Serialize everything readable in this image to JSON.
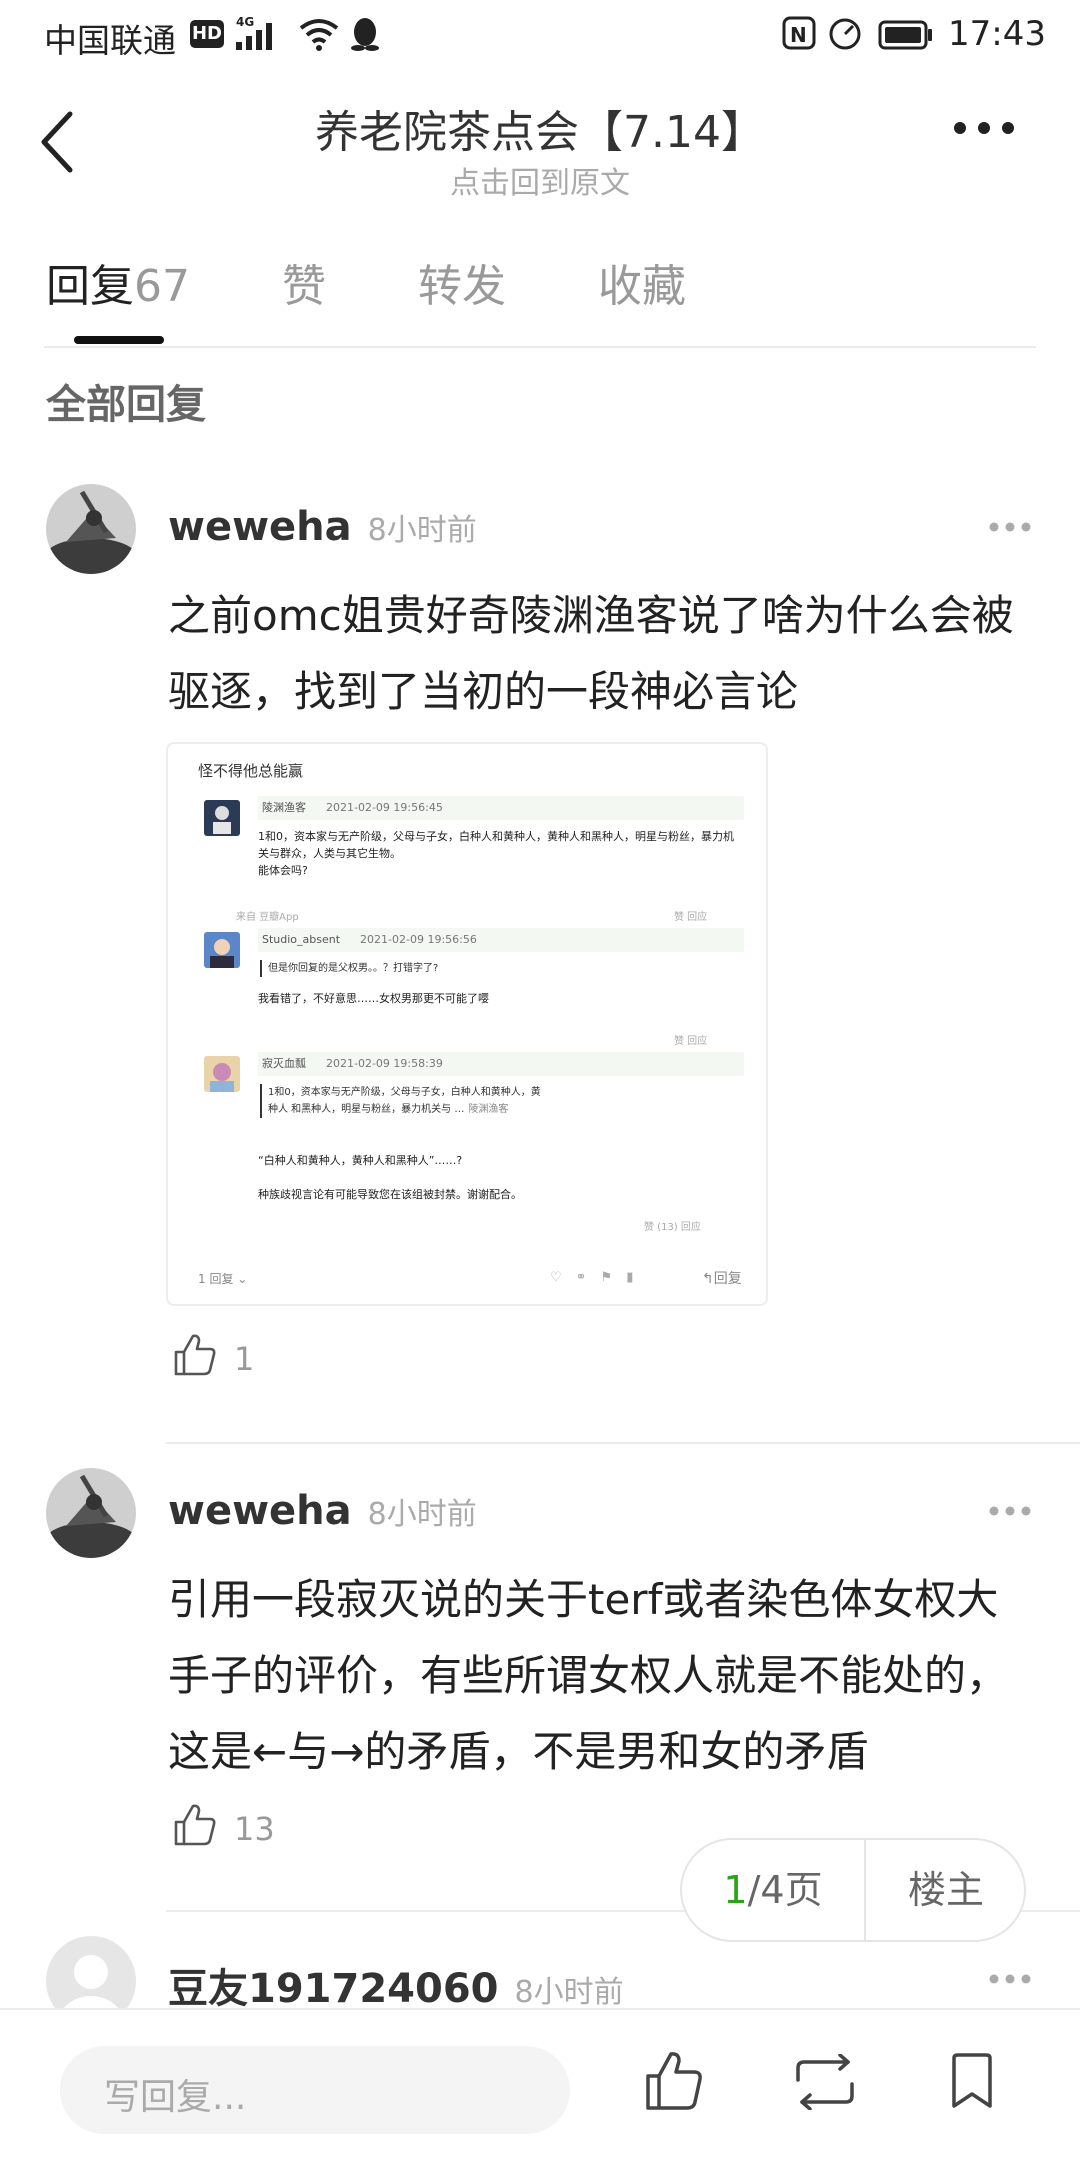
{
  "status_bar": {
    "carrier": "中国联通",
    "hd": "HD",
    "network": "4G",
    "time": "17:43"
  },
  "header": {
    "title": "养老院茶点会【7.14】",
    "subtitle": "点击回到原文",
    "back_icon": "chevron-left-icon",
    "more_icon": "more-horizontal-icon"
  },
  "tabs": [
    {
      "label": "回复",
      "count": "67",
      "active": true
    },
    {
      "label": "赞",
      "count": "",
      "active": false
    },
    {
      "label": "转发",
      "count": "",
      "active": false
    },
    {
      "label": "收藏",
      "count": "",
      "active": false
    }
  ],
  "section_heading": "全部回复",
  "comments": [
    {
      "author": "weweha",
      "time": "8小时前",
      "text": "之前omc姐贵好奇陵渊渔客说了啥为什么会被驱逐，找到了当初的一段神必言论",
      "likes": "1",
      "attachment": {
        "header": "怪不得他总能赢",
        "replies": [
          {
            "name": "陵渊渔客",
            "date": "2021-02-09 19:56:45",
            "lines": [
              "1和0，资本家与无产阶级，父母与子女，白种人和黄种人，黄种人和黑种人，明星与粉丝，暴力机",
              "关与群众，人类与其它生物。",
              "能体会吗?"
            ],
            "source": "来自 豆瓣App",
            "actions": "赞   回应"
          },
          {
            "name": "Studio_absent",
            "date": "2021-02-09 19:56:56",
            "quote": "但是你回复的是父权男。。？打错字了?",
            "lines": [
              "我看错了，不好意思……女权男那更不可能了嘤"
            ],
            "actions": "赞   回应"
          },
          {
            "name": "寂灭血瓢",
            "date": "2021-02-09 19:58:39",
            "quote": "1和0，资本家与无产阶级，父母与子女，白种人和黄种人，黄种人 和黑种人，明星与粉丝，暴力机关与 …",
            "quote_author": "陵渊渔客",
            "lines": [
              "“白种人和黄种人，黄种人和黑种人”……?",
              "",
              "种族歧视言论有可能导致您在该组被封禁。谢谢配合。"
            ],
            "actions": "赞 (13)   回应"
          }
        ],
        "reply_count": "1 回复 ⌄",
        "reply_button": "↰回复"
      }
    },
    {
      "author": "weweha",
      "time": "8小时前",
      "text": "引用一段寂灭说的关于terf或者染色体女权大手子的评价，有些所谓女权人就是不能处的，这是←与→的矛盾，不是男和女的矛盾",
      "likes": "13"
    },
    {
      "author": "豆友191724060",
      "time": "8小时前"
    }
  ],
  "pager": {
    "current": "1",
    "total": "/4页",
    "op_label": "楼主"
  },
  "bottom_bar": {
    "reply_placeholder": "写回复...",
    "like_icon": "thumbs-up-icon",
    "share_icon": "repost-icon",
    "bookmark_icon": "bookmark-icon"
  },
  "colors": {
    "accent": "#2aa515",
    "text_primary": "#222222",
    "text_secondary": "#aaaaaa"
  }
}
